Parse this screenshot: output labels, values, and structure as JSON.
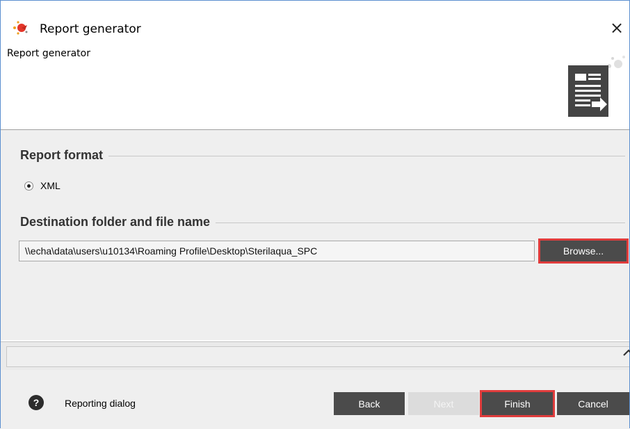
{
  "window": {
    "title": "Report generator",
    "close_glyph": "×"
  },
  "header": {
    "title": "Report generator",
    "icon": "report-export-icon"
  },
  "report_format": {
    "section_title": "Report format",
    "options": [
      {
        "label": "XML",
        "selected": true
      }
    ]
  },
  "destination": {
    "section_title": "Destination folder and file name",
    "path_value": "\\\\echa\\data\\users\\u10134\\Roaming Profile\\Desktop\\Sterilaqua_SPC",
    "browse_label": "Browse..."
  },
  "footer": {
    "help_glyph": "?",
    "label": "Reporting dialog",
    "buttons": {
      "back": "Back",
      "next": "Next",
      "finish": "Finish",
      "cancel": "Cancel"
    }
  },
  "colors": {
    "button_bg": "#4b4b4b",
    "highlight": "#e03c3c",
    "panel_bg": "#efefef",
    "window_border": "#5b8fd0"
  }
}
